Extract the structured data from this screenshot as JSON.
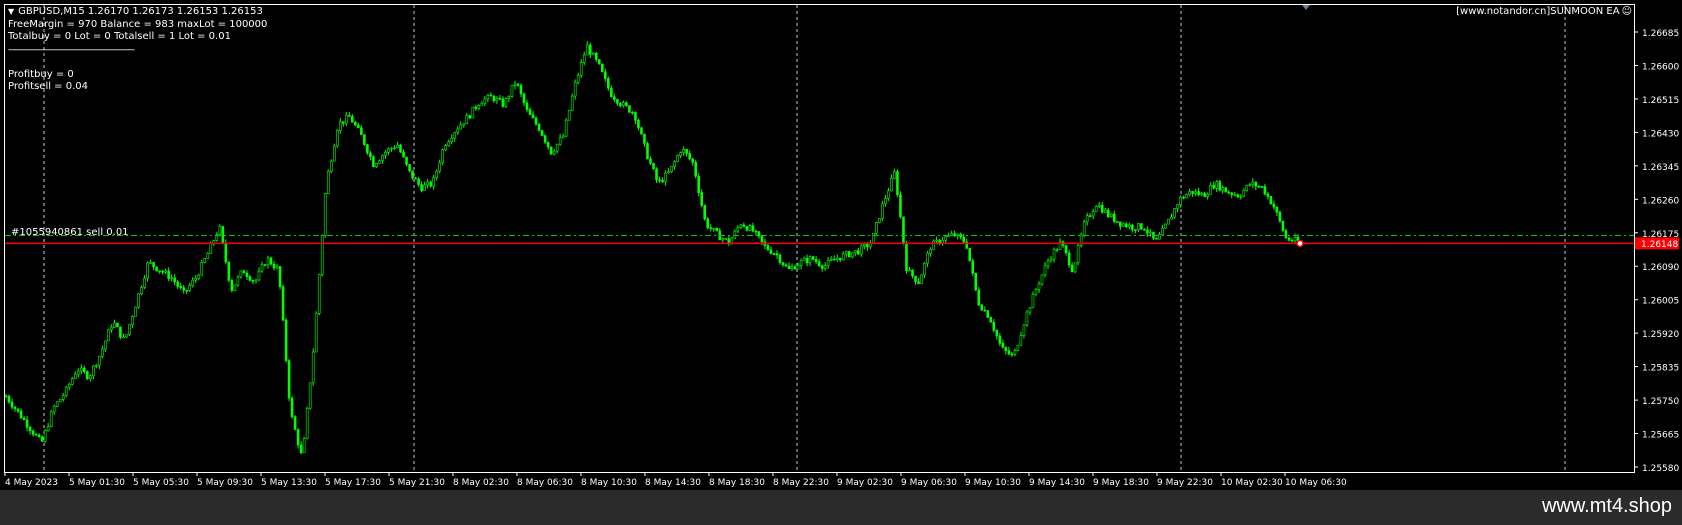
{
  "chart": {
    "symbol_line": "GBPUSD,M15  1.26170 1.26173 1.26153 1.26153",
    "info_lines": [
      "FreeMargin = 970  Balance = 983  maxLot = 100000",
      "Totalbuy = 0  Lot = 0  Totalsell = 1  Lot = 0.01",
      "--------------------------------------------------------",
      "",
      "Profitbuy = 0",
      "Profitsell = 0.04"
    ],
    "ea_badge": "[www.notandor.cn]SUNMOON EA",
    "order_label": "#1055940861 sell 0.01",
    "current_price": "1.26148",
    "price_axis": [
      "1.26685",
      "1.26600",
      "1.26515",
      "1.26430",
      "1.26345",
      "1.26260",
      "1.26175",
      "1.26090",
      "1.26005",
      "1.25920",
      "1.25835",
      "1.25750",
      "1.25665",
      "1.25580"
    ],
    "time_axis": [
      "4 May 2023",
      "5 May 01:30",
      "5 May 05:30",
      "5 May 09:30",
      "5 May 13:30",
      "5 May 17:30",
      "5 May 21:30",
      "8 May 02:30",
      "8 May 06:30",
      "8 May 10:30",
      "8 May 14:30",
      "8 May 18:30",
      "8 May 22:30",
      "9 May 02:30",
      "9 May 06:30",
      "9 May 10:30",
      "9 May 14:30",
      "9 May 18:30",
      "9 May 22:30",
      "10 May 02:30",
      "10 May 06:30"
    ],
    "colors": {
      "background": "#000000",
      "candles": "#00ff00",
      "bid_line": "#ff0000",
      "grid": "#c8c8c8",
      "order_line": "#00c800",
      "price_tag": "#ff0000",
      "footer": "#2b2b2b"
    },
    "price_path": [
      [
        0,
        1.2576
      ],
      [
        1,
        1.2572
      ],
      [
        2,
        1.2568
      ],
      [
        3,
        1.2564
      ],
      [
        4,
        1.2573
      ],
      [
        5,
        1.2577
      ],
      [
        6,
        1.2583
      ],
      [
        7,
        1.2581
      ],
      [
        8,
        1.2587
      ],
      [
        9,
        1.2595
      ],
      [
        10,
        1.259
      ],
      [
        11,
        1.26
      ],
      [
        12,
        1.261
      ],
      [
        13,
        1.2608
      ],
      [
        14,
        1.2606
      ],
      [
        15,
        1.2602
      ],
      [
        16,
        1.2606
      ],
      [
        17,
        1.2612
      ],
      [
        18,
        1.2619
      ],
      [
        19,
        1.2603
      ],
      [
        20,
        1.2608
      ],
      [
        21,
        1.2605
      ],
      [
        22,
        1.2611
      ],
      [
        23,
        1.2608
      ],
      [
        24,
        1.2572
      ],
      [
        25,
        1.256
      ],
      [
        26,
        1.259
      ],
      [
        27,
        1.263
      ],
      [
        28,
        1.2645
      ],
      [
        29,
        1.2647
      ],
      [
        30,
        1.2642
      ],
      [
        31,
        1.2635
      ],
      [
        32,
        1.2638
      ],
      [
        33,
        1.264
      ],
      [
        34,
        1.2633
      ],
      [
        35,
        1.2629
      ],
      [
        36,
        1.263
      ],
      [
        37,
        1.264
      ],
      [
        38,
        1.2644
      ],
      [
        39,
        1.2647
      ],
      [
        40,
        1.2651
      ],
      [
        41,
        1.2652
      ],
      [
        42,
        1.265
      ],
      [
        43,
        1.2656
      ],
      [
        44,
        1.2648
      ],
      [
        45,
        1.2644
      ],
      [
        46,
        1.2638
      ],
      [
        47,
        1.2642
      ],
      [
        48,
        1.2655
      ],
      [
        49,
        1.2665
      ],
      [
        50,
        1.266
      ],
      [
        51,
        1.2653
      ],
      [
        52,
        1.265
      ],
      [
        53,
        1.2648
      ],
      [
        54,
        1.2638
      ],
      [
        55,
        1.263
      ],
      [
        56,
        1.2633
      ],
      [
        57,
        1.2639
      ],
      [
        58,
        1.2635
      ],
      [
        59,
        1.262
      ],
      [
        60,
        1.2617
      ],
      [
        61,
        1.2615
      ],
      [
        62,
        1.262
      ],
      [
        63,
        1.2618
      ],
      [
        64,
        1.2614
      ],
      [
        65,
        1.2612
      ],
      [
        66,
        1.2608
      ],
      [
        67,
        1.261
      ],
      [
        68,
        1.2611
      ],
      [
        69,
        1.2609
      ],
      [
        70,
        1.2611
      ],
      [
        71,
        1.2612
      ],
      [
        72,
        1.2613
      ],
      [
        73,
        1.2615
      ],
      [
        74,
        1.2625
      ],
      [
        75,
        1.2633
      ],
      [
        76,
        1.2608
      ],
      [
        77,
        1.2605
      ],
      [
        78,
        1.2614
      ],
      [
        79,
        1.2616
      ],
      [
        80,
        1.2617
      ],
      [
        81,
        1.2615
      ],
      [
        82,
        1.26
      ],
      [
        83,
        1.2596
      ],
      [
        84,
        1.2588
      ],
      [
        85,
        1.2586
      ],
      [
        86,
        1.2596
      ],
      [
        87,
        1.2604
      ],
      [
        88,
        1.2611
      ],
      [
        89,
        1.2615
      ],
      [
        90,
        1.2608
      ],
      [
        91,
        1.262
      ],
      [
        92,
        1.2625
      ],
      [
        93,
        1.2622
      ],
      [
        94,
        1.262
      ],
      [
        95,
        1.2619
      ],
      [
        96,
        1.2619
      ],
      [
        97,
        1.2615
      ],
      [
        98,
        1.262
      ],
      [
        99,
        1.2626
      ],
      [
        100,
        1.2628
      ],
      [
        101,
        1.2627
      ],
      [
        102,
        1.263
      ],
      [
        103,
        1.2628
      ],
      [
        104,
        1.2627
      ],
      [
        105,
        1.263
      ],
      [
        106,
        1.2629
      ],
      [
        107,
        1.2624
      ],
      [
        108,
        1.2616
      ],
      [
        109,
        1.26153
      ]
    ]
  },
  "footer": {
    "watermark": "www.mt4.shop"
  }
}
